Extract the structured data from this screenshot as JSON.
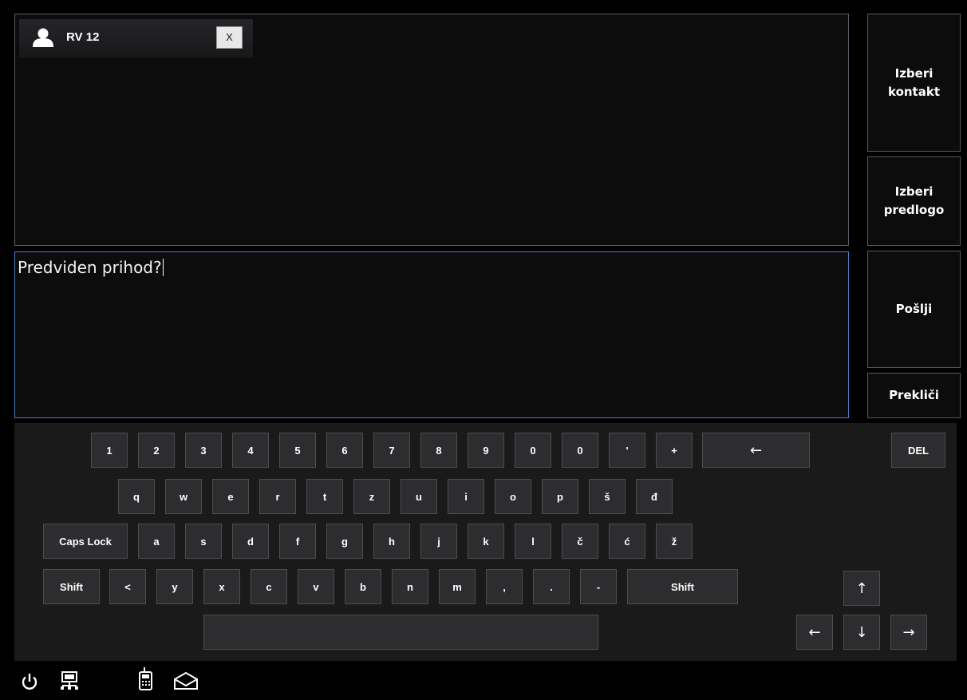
{
  "recipient": {
    "name": "RV 12",
    "remove_label": "X"
  },
  "message": {
    "text": "Predviden prihod?"
  },
  "side_buttons": {
    "select_contact": [
      "Izberi",
      "kontakt"
    ],
    "select_template": [
      "Izberi",
      "predlogo"
    ],
    "send": "Pošlji",
    "cancel": "Prekliči"
  },
  "keyboard": {
    "row1": [
      "1",
      "2",
      "3",
      "4",
      "5",
      "6",
      "7",
      "8",
      "9",
      "0",
      "0",
      "'",
      "+"
    ],
    "backspace": "←",
    "del": "DEL",
    "row2": [
      "q",
      "w",
      "e",
      "r",
      "t",
      "z",
      "u",
      "i",
      "o",
      "p",
      "š",
      "đ"
    ],
    "caps": "Caps Lock",
    "row3": [
      "a",
      "s",
      "d",
      "f",
      "g",
      "h",
      "j",
      "k",
      "l",
      "č",
      "ć",
      "ž"
    ],
    "shift_left": "Shift",
    "row4": [
      "<",
      "y",
      "x",
      "c",
      "v",
      "b",
      "n",
      "m",
      ",",
      ".",
      "-"
    ],
    "shift_right": "Shift",
    "arrows": {
      "up": "↑",
      "left": "←",
      "down": "↓",
      "right": "→"
    }
  },
  "taskbar": {
    "icons": [
      "power-icon",
      "network-icon",
      "phone-icon",
      "mail-icon"
    ]
  },
  "colors": {
    "message_border": "#4c7cc4",
    "panel_bg": "#0c0c0d",
    "key_bg": "#2d2d2f"
  }
}
